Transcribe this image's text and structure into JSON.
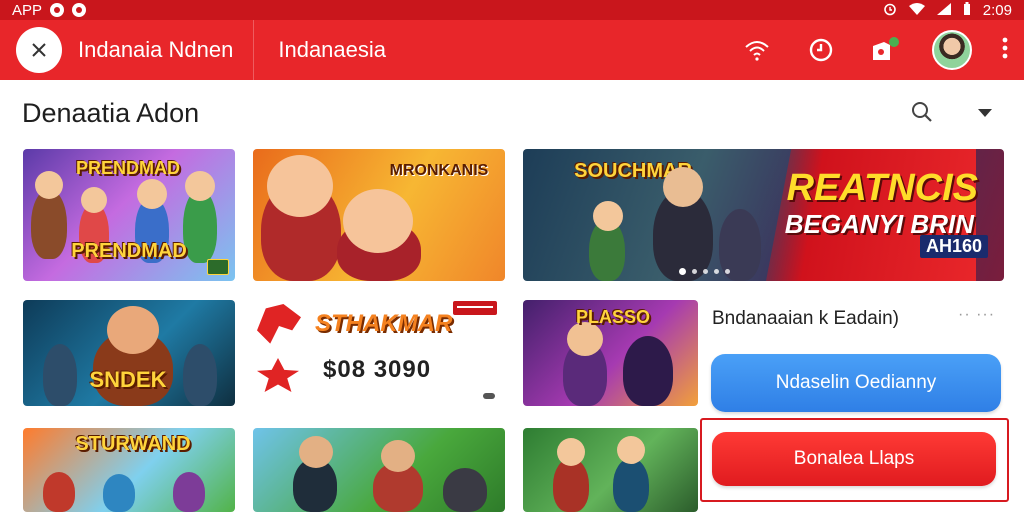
{
  "status_bar": {
    "app_label": "APP",
    "time": "2:09",
    "icons": [
      "notification-dot-icon",
      "notification-dot-icon",
      "alarm-icon",
      "wifi-icon",
      "signal-icon",
      "battery-icon"
    ]
  },
  "app_bar": {
    "title": "Indanaia Ndnen",
    "subtitle": "Indanaesia",
    "icons": [
      "close-icon",
      "wifi-icon",
      "history-icon",
      "notification-icon",
      "avatar",
      "more-vert-icon"
    ],
    "colors": {
      "bar": "#e8262a",
      "status": "#c9161c"
    }
  },
  "section": {
    "title": "Denaatia Adon",
    "icons": [
      "search-icon",
      "dropdown-icon"
    ]
  },
  "tiles": [
    {
      "label": "PRENDMAD"
    },
    {
      "label": "MRONKANIS"
    },
    {
      "label": "SOUCHMAR",
      "banner_title": "REATNCIS",
      "banner_sub": "BEGANYI BRIN",
      "banner_tag": "AH160"
    },
    {
      "label": "SNDEK"
    },
    {
      "label": "STHAKMAR",
      "price": "$08 3090"
    },
    {
      "label": "PLASSO"
    },
    {
      "label": "STURWAND"
    },
    {
      "label": ""
    },
    {
      "label": ""
    }
  ],
  "side_panel": {
    "title": "Bndanaaian k Eadain)",
    "more": "·· ···",
    "primary_button": "Ndaselin Oedianny",
    "cta_button": "Bonalea Llaps",
    "colors": {
      "primary": "#2f7fe6",
      "cta": "#e01b1f"
    }
  }
}
